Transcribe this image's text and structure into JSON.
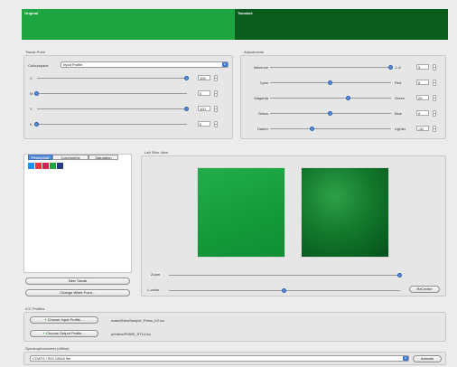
{
  "swatches": {
    "original_label": "Original",
    "tweaked_label": "Tweaked",
    "original_color": "#1ea542",
    "tweaked_color": "#0a5c1c"
  },
  "tweak_point": {
    "group_label": "Tweak Point",
    "colourspace_label": "Colourspace",
    "colourspace_value": "Input Profile",
    "channels": [
      {
        "label": "C",
        "value": "100",
        "level": 1.0
      },
      {
        "label": "M",
        "value": "0",
        "level": 0.0
      },
      {
        "label": "Y",
        "value": "100",
        "level": 1.0
      },
      {
        "label": "K",
        "value": "0",
        "level": 0.0
      }
    ]
  },
  "adjustments": {
    "group_label": "Adjustments",
    "sliders": [
      {
        "left": "Influence",
        "right": "1–5",
        "value": "5",
        "level": 1.0
      },
      {
        "left": "Cyan",
        "right": "Red",
        "value": "0",
        "level": 0.5
      },
      {
        "left": "Magenta",
        "right": "Green",
        "value": "29",
        "level": 0.65
      },
      {
        "left": "Yellow",
        "right": "Blue",
        "value": "0",
        "level": 0.5
      },
      {
        "left": "Darker",
        "right": "Lighter",
        "value": "-30",
        "level": 0.35
      }
    ]
  },
  "intent_tabs": [
    "Perceptual",
    "Colorimetric",
    "Saturation"
  ],
  "chips": [
    "#1e90ff",
    "#e8383d",
    "#d02552",
    "#1ea542",
    "#2a3a88"
  ],
  "buttons": {
    "new_tweak": "New Tweak",
    "change_white_point": "Change White Point…"
  },
  "lab_view": {
    "group_label": "Lab Slice View",
    "zoom_label": "Zoom",
    "zoom_level": 1.0,
    "lvalue_label": "L-value",
    "lvalue_level": 0.5,
    "recentre_label": "ReCentre"
  },
  "icc": {
    "group_label": "ICC Profiles",
    "input_button": "Choose Input Profile…",
    "input_path": "match/NewSample_Press_K2.icc",
    "output_button": "Choose Output Profile…",
    "output_path": "printers/R9505_ST14.icc"
  },
  "spectro": {
    "group_label": "Spectrophotometer (offline)",
    "select_value": "CGATS / ISO 12642 file",
    "activate_label": "Activate"
  }
}
